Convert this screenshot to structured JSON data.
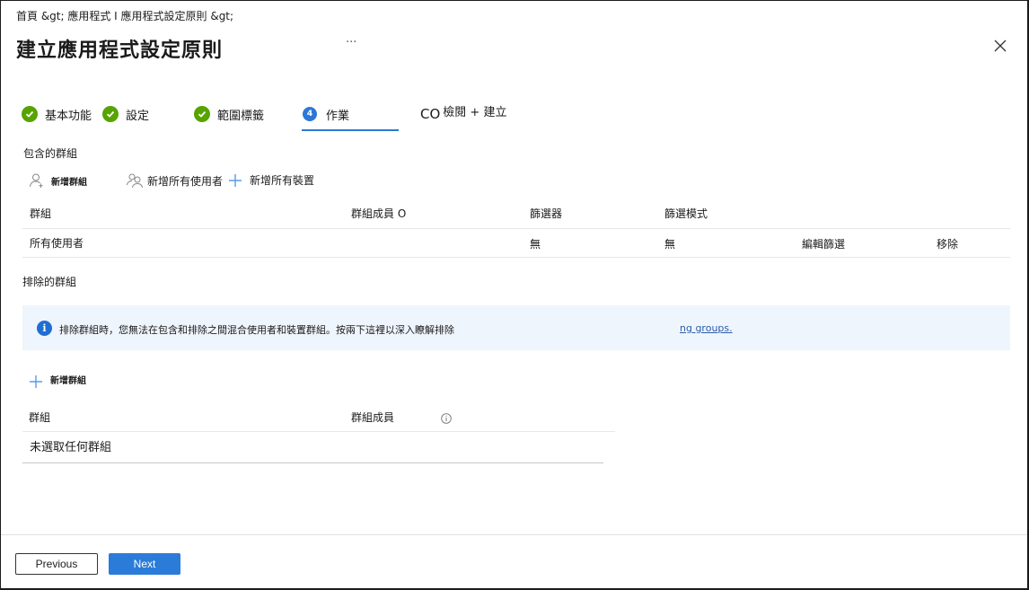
{
  "header": {
    "breadcrumb": "首頁 &gt;  應用程式 I 應用程式設定原則 &gt;",
    "title": "建立應用程式設定原則",
    "more_label": "···",
    "close_icon": "close-icon"
  },
  "steps": [
    {
      "label": "基本功能",
      "state": "complete"
    },
    {
      "label": "設定",
      "state": "complete"
    },
    {
      "label": "範圍標籤",
      "state": "complete"
    },
    {
      "number": "4",
      "label": "作業",
      "state": "current"
    },
    {
      "prefix": "CO",
      "label": "檢閱 + 建立",
      "state": "upcoming"
    }
  ],
  "included": {
    "section_label": "包含的群組",
    "commands": [
      {
        "label": "新增群組",
        "icon": "add-person-icon"
      },
      {
        "label": "新增所有使用者",
        "icon": "people-icon"
      },
      {
        "label": "新增所有裝置",
        "icon": "plus-icon"
      }
    ],
    "columns": [
      "群組",
      "群組成員 O",
      "篩選器",
      "篩選模式"
    ],
    "rows": [
      {
        "group": "所有使用者",
        "filter": "無",
        "filter_mode": "無",
        "edit_filter": "編輯篩選",
        "remove": "移除"
      }
    ]
  },
  "excluded": {
    "section_label": "排除的群組",
    "info_text": "排除群組時，您無法在包含和排除之間混合使用者和裝置群組。按兩下這裡以深入瞭解排除",
    "info_link": "ng groups.",
    "add_label": "新增群組",
    "columns": [
      "群組",
      "群組成員"
    ],
    "empty_text": "未選取任何群組"
  },
  "footer": {
    "previous_label": "Previous",
    "next_label": "Next"
  },
  "colors": {
    "accent": "#2b78d8",
    "complete": "#57a300",
    "info_bg": "#eff5fd"
  }
}
